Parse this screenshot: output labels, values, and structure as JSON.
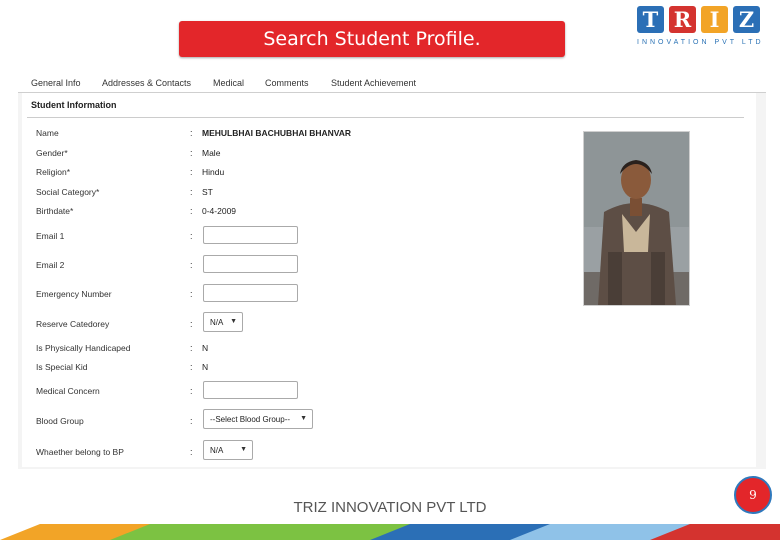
{
  "slide": {
    "title": "Search Student Profile.",
    "footer": "TRIZ INNOVATION PVT LTD",
    "page_number": "9"
  },
  "logo": {
    "letters": [
      "T",
      "R",
      "I",
      "Z"
    ],
    "tile_colors": [
      "#2b6fb6",
      "#d4332f",
      "#f2a427",
      "#2b6fb6"
    ],
    "tagline": "INNOVATION PVT LTD"
  },
  "tabs": [
    {
      "label": "General Info"
    },
    {
      "label": "Addresses & Contacts"
    },
    {
      "label": "Medical"
    },
    {
      "label": "Comments"
    },
    {
      "label": "Student Achievement"
    }
  ],
  "section_title": "Student Information",
  "fields": {
    "name": {
      "label": "Name",
      "value": "MEHULBHAI BACHUBHAI BHANVAR"
    },
    "gender": {
      "label": "Gender*",
      "value": "Male"
    },
    "religion": {
      "label": "Religion*",
      "value": "Hindu"
    },
    "social_category": {
      "label": "Social Category*",
      "value": "ST"
    },
    "birthdate": {
      "label": "Birthdate*",
      "value": "0-4-2009"
    },
    "email1": {
      "label": "Email 1",
      "value": ""
    },
    "email2": {
      "label": "Email 2",
      "value": ""
    },
    "emergency_number": {
      "label": "Emergency Number",
      "value": ""
    },
    "reserve_category": {
      "label": "Reserve Catedorey",
      "value": "N/A"
    },
    "physically_handicaped": {
      "label": "Is Physically Handicaped",
      "value": "N"
    },
    "special_kid": {
      "label": "Is Special Kid",
      "value": "N"
    },
    "medical_concern": {
      "label": "Medical Concern",
      "value": ""
    },
    "blood_group": {
      "label": "Blood Group",
      "value": "--Select Blood Group--"
    },
    "belong_to_bp": {
      "label": "Whaether belong to BP",
      "value": "N/A"
    }
  },
  "colors": {
    "banner": "#e3262a",
    "badge_border": "#2f79bd"
  }
}
